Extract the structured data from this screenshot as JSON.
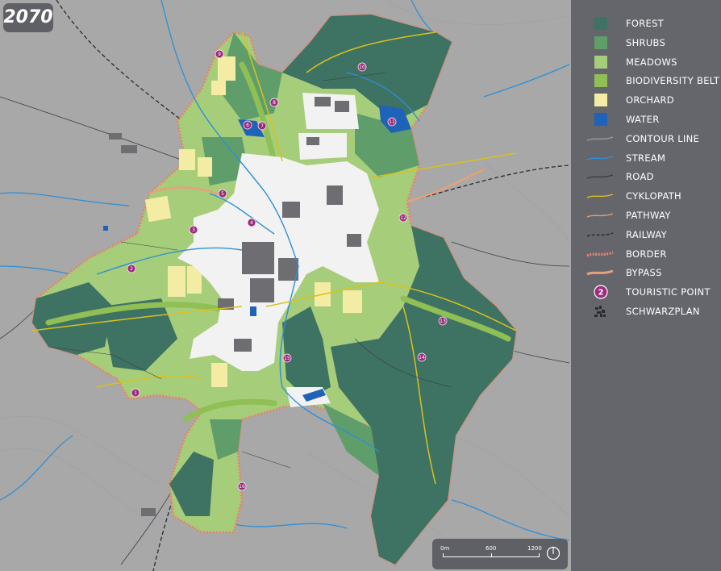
{
  "year": "2070",
  "legend": [
    {
      "label": "FOREST",
      "type": "square",
      "color": "#3e7263",
      "icon": "forest-swatch"
    },
    {
      "label": "SHRUBS",
      "type": "square",
      "color": "#5f9e6a",
      "icon": "shrubs-swatch"
    },
    {
      "label": "MEADOWS",
      "type": "square",
      "color": "#a6cd7a",
      "icon": "meadows-swatch"
    },
    {
      "label": "BIODIVERSITY BELT",
      "type": "square",
      "color": "#8fbf55",
      "icon": "biodiversity-swatch"
    },
    {
      "label": "ORCHARD",
      "type": "square",
      "color": "#f4eca5",
      "icon": "orchard-swatch"
    },
    {
      "label": "WATER",
      "type": "square",
      "color": "#1f63b8",
      "icon": "water-swatch"
    },
    {
      "label": "CONTOUR LINE",
      "type": "line",
      "color": "#9a9aa2",
      "icon": "contour-line-icon"
    },
    {
      "label": "STREAM",
      "type": "line",
      "color": "#2e8fd6",
      "icon": "stream-line-icon"
    },
    {
      "label": "ROAD",
      "type": "line",
      "color": "#3c3c40",
      "icon": "road-line-icon"
    },
    {
      "label": "CYKLOPATH",
      "type": "line",
      "color": "#d8c21c",
      "icon": "cyclopath-line-icon"
    },
    {
      "label": "PATHWAY",
      "type": "line",
      "color": "#e2a26b",
      "icon": "pathway-line-icon"
    },
    {
      "label": "RAILWAY",
      "type": "dashed",
      "color": "#2a2a2e",
      "icon": "railway-line-icon"
    },
    {
      "label": "BORDER",
      "type": "dotted",
      "color": "#e8836f",
      "icon": "border-line-icon"
    },
    {
      "label": "BYPASS",
      "type": "thick",
      "color": "#e8a07a",
      "icon": "bypass-line-icon"
    },
    {
      "label": "TOURISTIC POINT",
      "type": "poi",
      "color": "#9c2a7d",
      "value": "2",
      "icon": "touristic-point-icon"
    },
    {
      "label": "SCHWARZPLAN",
      "type": "pattern",
      "color": "#2a2a2e",
      "icon": "schwarzplan-icon"
    }
  ],
  "scale": {
    "ticks": [
      "0m",
      "600",
      "1200"
    ]
  },
  "poi_labels": [
    "1",
    "2",
    "3",
    "4",
    "5",
    "6",
    "7",
    "8",
    "9",
    "10",
    "11",
    "12",
    "13",
    "14",
    "15",
    "16"
  ],
  "colors": {
    "forest": "#3e7263",
    "shrubs": "#5f9e6a",
    "meadows": "#a6cd7a",
    "biodiversity": "#8fbf55",
    "orchard": "#f4eca5",
    "water": "#1f63b8",
    "stream": "#2e8fd6",
    "cyclopath": "#d8c21c",
    "bypass": "#e8a07a",
    "border": "#e8836f",
    "poi": "#9c2a7d",
    "urban": "#f2f2f2"
  }
}
